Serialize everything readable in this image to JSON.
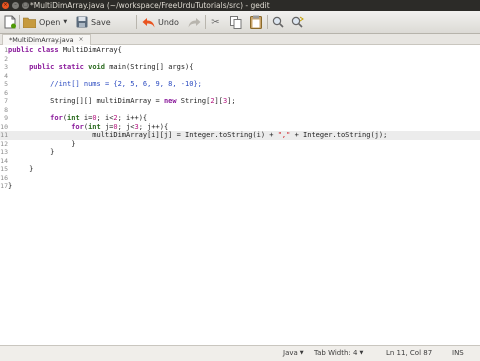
{
  "window": {
    "title": "*MultiDimArray.java (~/workspace/FreeUrduTutorials/src) - gedit",
    "buttons": {
      "close": "×",
      "minimize": "–",
      "maximize": "□"
    }
  },
  "toolbar": {
    "open_label": "Open",
    "save_label": "Save",
    "undo_label": "Undo"
  },
  "tab": {
    "label": "*MultiDimArray.java",
    "close": "×"
  },
  "editor": {
    "lines": [
      {
        "n": "1",
        "parts": [
          [
            "kw",
            "public "
          ],
          [
            "kw",
            "class "
          ],
          [
            "",
            "MultiDimArray{"
          ]
        ]
      },
      {
        "n": "2",
        "parts": [
          [
            "",
            ""
          ]
        ]
      },
      {
        "n": "3",
        "parts": [
          [
            "",
            "     "
          ],
          [
            "kw",
            "public "
          ],
          [
            "kw",
            "static "
          ],
          [
            "ty",
            "void "
          ],
          [
            "",
            "main(String[] args){"
          ]
        ]
      },
      {
        "n": "4",
        "parts": [
          [
            "",
            ""
          ]
        ]
      },
      {
        "n": "5",
        "parts": [
          [
            "",
            "          "
          ],
          [
            "cm",
            "//int[] nums = {2, 5, 6, 9, 8, -10};"
          ]
        ]
      },
      {
        "n": "6",
        "parts": [
          [
            "",
            ""
          ]
        ]
      },
      {
        "n": "7",
        "parts": [
          [
            "",
            "          String[][] multiDimArray = "
          ],
          [
            "kw",
            "new "
          ],
          [
            "",
            "String["
          ],
          [
            "nm",
            "2"
          ],
          [
            "",
            "]["
          ],
          [
            "nm",
            "3"
          ],
          [
            "",
            "];"
          ]
        ]
      },
      {
        "n": "8",
        "parts": [
          [
            "",
            ""
          ]
        ]
      },
      {
        "n": "9",
        "parts": [
          [
            "",
            "          "
          ],
          [
            "kw",
            "for"
          ],
          [
            "",
            "("
          ],
          [
            "ty",
            "int "
          ],
          [
            "",
            "i="
          ],
          [
            "nm",
            "0"
          ],
          [
            "",
            "; i<"
          ],
          [
            "nm",
            "2"
          ],
          [
            "",
            "; i++){"
          ]
        ]
      },
      {
        "n": "10",
        "parts": [
          [
            "",
            "               "
          ],
          [
            "kw",
            "for"
          ],
          [
            "",
            "("
          ],
          [
            "ty",
            "int "
          ],
          [
            "",
            "j="
          ],
          [
            "nm",
            "0"
          ],
          [
            "",
            "; j<"
          ],
          [
            "nm",
            "3"
          ],
          [
            "",
            "; j++){"
          ]
        ]
      },
      {
        "n": "11",
        "parts": [
          [
            "",
            "                    multiDimArray[i][j] = Integer.toString(i) + "
          ],
          [
            "st",
            "\",\""
          ],
          [
            "",
            " + Integer.toString(j);"
          ]
        ]
      },
      {
        "n": "12",
        "parts": [
          [
            "",
            "               }"
          ]
        ]
      },
      {
        "n": "13",
        "parts": [
          [
            "",
            "          }"
          ]
        ]
      },
      {
        "n": "14",
        "parts": [
          [
            "",
            ""
          ]
        ]
      },
      {
        "n": "15",
        "parts": [
          [
            "",
            "     }"
          ]
        ]
      },
      {
        "n": "16",
        "parts": [
          [
            "",
            ""
          ]
        ]
      },
      {
        "n": "17",
        "parts": [
          [
            "",
            "}"
          ]
        ]
      }
    ],
    "current_line": "11"
  },
  "status": {
    "language": "Java",
    "tab_width": "Tab Width: 4",
    "position": "Ln 11, Col 87",
    "mode": "INS"
  }
}
